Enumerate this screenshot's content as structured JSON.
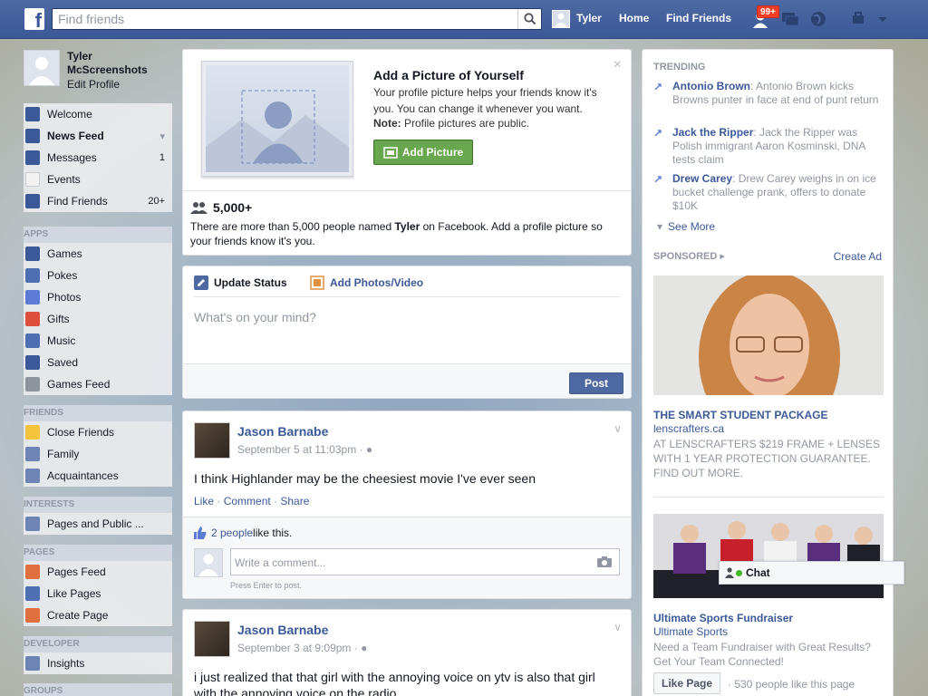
{
  "topbar": {
    "logo": "f",
    "search_placeholder": "Find friends",
    "user_name": "Tyler",
    "home_label": "Home",
    "find_friends_label": "Find Friends",
    "notif_badge": "99+"
  },
  "profile": {
    "name": "Tyler McScreenshots",
    "edit_label": "Edit Profile"
  },
  "nav": {
    "main": [
      {
        "label": "Welcome",
        "icon": "facebook-icon",
        "color": "#3b5998"
      },
      {
        "label": "News Feed",
        "icon": "news-feed-icon",
        "color": "#3b5998"
      },
      {
        "label": "Messages",
        "icon": "messages-icon",
        "color": "#3b5998",
        "count": "1"
      },
      {
        "label": "Events",
        "icon": "events-icon",
        "color": "#f2f2f2",
        "count": ""
      },
      {
        "label": "Find Friends",
        "icon": "find-friends-icon",
        "color": "#3b5998",
        "count": "20+"
      }
    ],
    "apps_header": "APPS",
    "apps": [
      {
        "label": "Games",
        "icon": "games-icon",
        "color": "#3b5998"
      },
      {
        "label": "Pokes",
        "icon": "pokes-icon",
        "color": "#4f6fb3"
      },
      {
        "label": "Photos",
        "icon": "photos-icon",
        "color": "#5b7bd5"
      },
      {
        "label": "Gifts",
        "icon": "gifts-icon",
        "color": "#e04f3e"
      },
      {
        "label": "Music",
        "icon": "music-icon",
        "color": "#4f6fb3"
      },
      {
        "label": "Saved",
        "icon": "saved-icon",
        "color": "#3b5998"
      },
      {
        "label": "Games Feed",
        "icon": "games-feed-icon",
        "color": "#8d949e"
      }
    ],
    "friends_header": "FRIENDS",
    "friends": [
      {
        "label": "Close Friends",
        "icon": "star-icon",
        "color": "#f5c33b"
      },
      {
        "label": "Family",
        "icon": "family-icon",
        "color": "#6d84b4"
      },
      {
        "label": "Acquaintances",
        "icon": "acquaintances-icon",
        "color": "#6d84b4"
      }
    ],
    "interests_header": "INTERESTS",
    "interests": [
      {
        "label": "Pages and Public ...",
        "icon": "rss-icon",
        "color": "#6d84b4"
      }
    ],
    "pages_header": "PAGES",
    "pages": [
      {
        "label": "Pages Feed",
        "icon": "megaphone-icon",
        "color": "#e0703e"
      },
      {
        "label": "Like Pages",
        "icon": "thumbs-up-icon",
        "color": "#4f6fb3"
      },
      {
        "label": "Create Page",
        "icon": "plus-icon",
        "color": "#e0703e"
      }
    ],
    "developer_header": "DEVELOPER",
    "developer": [
      {
        "label": "Insights",
        "icon": "insights-icon",
        "color": "#6d84b4"
      }
    ],
    "groups_header": "GROUPS"
  },
  "pic_card": {
    "title": "Add a Picture of Yourself",
    "desc": "Your profile picture helps your friends know it's you. You can change it whenever you want.",
    "note_label": "Note:",
    "note_text": " Profile pictures are public.",
    "add_button": "Add Picture",
    "close": "×",
    "count": "5,000+",
    "people_desc_1": "There are more than 5,000 people named ",
    "people_name": "Tyler",
    "people_desc_2": " on Facebook. Add a profile picture so your friends know it's you."
  },
  "status": {
    "tab_update": "Update Status",
    "tab_photos": "Add Photos/Video",
    "placeholder": "What's on your mind?",
    "post_button": "Post"
  },
  "posts": [
    {
      "author": "Jason Barnabe",
      "date": "September 5 at 11:03pm · ",
      "text": "I think Highlander may be the cheesiest movie I've ever seen",
      "like": "Like",
      "comment": "Comment",
      "share": "Share",
      "likes_link": "2 people",
      "likes_text": " like this.",
      "comment_placeholder": "Write a comment...",
      "comment_hint": "Press Enter to post."
    },
    {
      "author": "Jason Barnabe",
      "date": "September 3 at 9:09pm · ",
      "text": "i just realized that that girl with the annoying voice on ytv is also that girl with the annoying voice on the radio"
    }
  ],
  "trending": {
    "header": "TRENDING",
    "items": [
      {
        "name": "Antonio Brown",
        "text": ": Antonio Brown kicks Browns punter in face at end of punt return"
      },
      {
        "name": "Jack the Ripper",
        "text": ": Jack the Ripper was Polish immigrant Aaron Kosminski, DNA tests claim"
      },
      {
        "name": "Drew Carey",
        "text": ": Drew Carey weighs in on ice bucket challenge prank, offers to donate $10K"
      }
    ],
    "see_more": "See More"
  },
  "sponsored": {
    "header": "SPONSORED",
    "create_ad": "Create Ad",
    "ads": [
      {
        "title": "THE SMART STUDENT PACKAGE",
        "url": "lenscrafters.ca",
        "desc": "AT LENSCRAFTERS $219 FRAME + LENSES WITH 1 YEAR PROTECTION GUARANTEE. FIND OUT MORE."
      },
      {
        "title": "Ultimate Sports Fundraiser",
        "url": "Ultimate Sports",
        "desc": "Need a Team Fundraiser with Great Results? Get Your Team Connected!",
        "like_button": "Like Page",
        "like_count": "· 530 people like this page"
      }
    ]
  },
  "chat": {
    "label": "Chat"
  }
}
